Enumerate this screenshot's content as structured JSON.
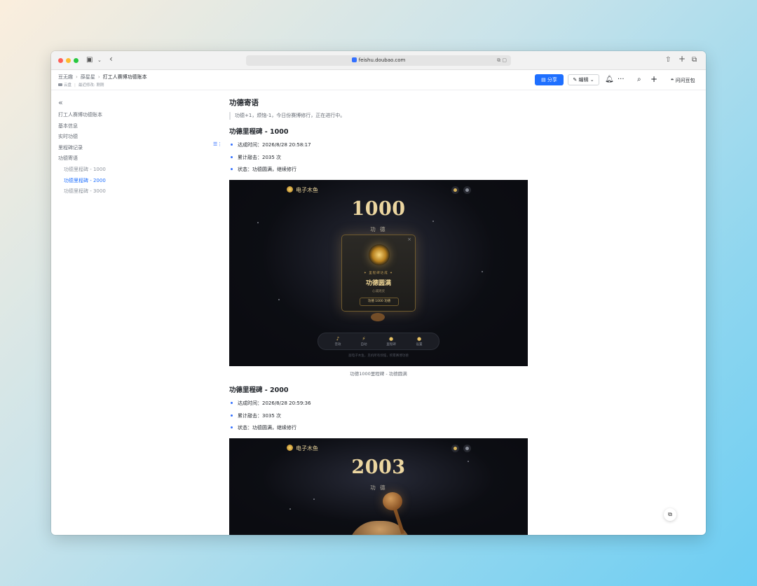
{
  "browser": {
    "url": "feishu.doubao.com"
  },
  "header": {
    "breadcrumbs": [
      "豆无趣",
      "薛星星",
      "打工人赛博功德账本"
    ],
    "location": "云盘",
    "last_modified": "最近修改: 刚刚",
    "share_label": "分享",
    "edit_label": "编辑",
    "ask_label": "问问豆包"
  },
  "sidebar": {
    "items": [
      {
        "label": "打工人赛博功德账本",
        "level": 1,
        "active": false
      },
      {
        "label": "基本信息",
        "level": 1,
        "active": false
      },
      {
        "label": "实时功德",
        "level": 1,
        "active": false
      },
      {
        "label": "里程碑记录",
        "level": 1,
        "active": false
      },
      {
        "label": "功德寄语",
        "level": 1,
        "active": false
      },
      {
        "label": "功德里程碑 - 1000",
        "level": 2,
        "active": false
      },
      {
        "label": "功德里程碑 - 2000",
        "level": 2,
        "active": true
      },
      {
        "label": "功德里程碑 - 3000",
        "level": 2,
        "active": false
      }
    ]
  },
  "doc": {
    "section_title": "功德寄语",
    "quote": "功德+1，烦恼-1，今日份赛博修行，正在进行中。",
    "milestones": [
      {
        "title": "功德里程碑 - 1000",
        "time": "达成时间：2026/8/28 20:58:17",
        "clicks": "累计敲击：2035 次",
        "status": "状态：功德圆满，继续修行",
        "caption": "功德1000里程碑 - 功德圆满"
      },
      {
        "title": "功德里程碑 - 2000",
        "time": "达成时间：2026/8/28 20:59:36",
        "clicks": "累计敲击：3035 次",
        "status": "状态：功德圆满，继续修行"
      }
    ]
  },
  "game": {
    "app_name": "电子木鱼",
    "merit_label": "功 德",
    "shot1": {
      "count": "1000",
      "modal_kicker": "✦ 里程碑达成 ✦",
      "modal_title": "功德圆满",
      "modal_sub": "心诚则灵",
      "modal_button": "功德 1000 功德"
    },
    "shot2": {
      "count": "2003"
    },
    "dock": [
      {
        "icon": "♪",
        "label": "音效"
      },
      {
        "icon": "⚡",
        "label": "自动"
      },
      {
        "icon": "●",
        "label": "里程碑"
      },
      {
        "icon": "●",
        "label": "设置"
      }
    ],
    "footer": "敲电子木鱼，见机所有烦恼，积累赛博功德"
  },
  "colors": {
    "accent": "#1e6fff",
    "gold": "#ecd6a0",
    "game_bg": "#0b0c11"
  }
}
